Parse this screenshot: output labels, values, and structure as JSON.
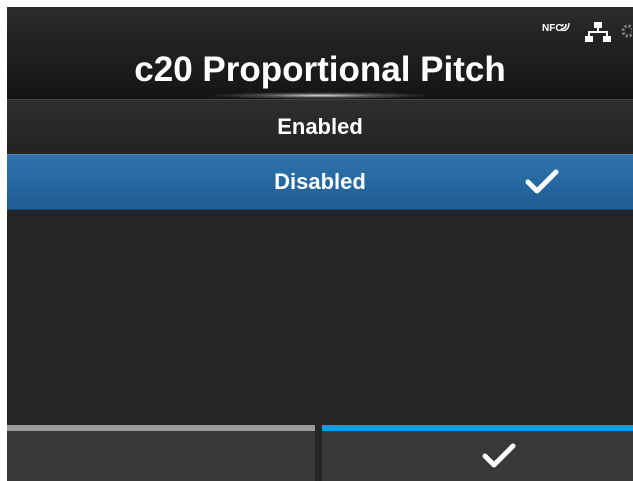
{
  "header": {
    "title": "c20 Proportional Pitch",
    "status": {
      "nfc_label": "NFC",
      "icons": [
        "nfc-icon",
        "network-icon",
        "gear-icon"
      ]
    }
  },
  "menu": {
    "items": [
      {
        "label": "Enabled",
        "selected": false
      },
      {
        "label": "Disabled",
        "selected": true,
        "icon": "checkmark-icon"
      }
    ]
  },
  "softkeys": {
    "left": {
      "label": "",
      "accent": "#9b9b9b"
    },
    "right": {
      "icon": "checkmark-icon",
      "accent": "#0a9ee6"
    }
  },
  "colors": {
    "background": "#252525",
    "selection": "#2f73ac",
    "accent": "#0a9ee6",
    "text": "#ffffff"
  }
}
